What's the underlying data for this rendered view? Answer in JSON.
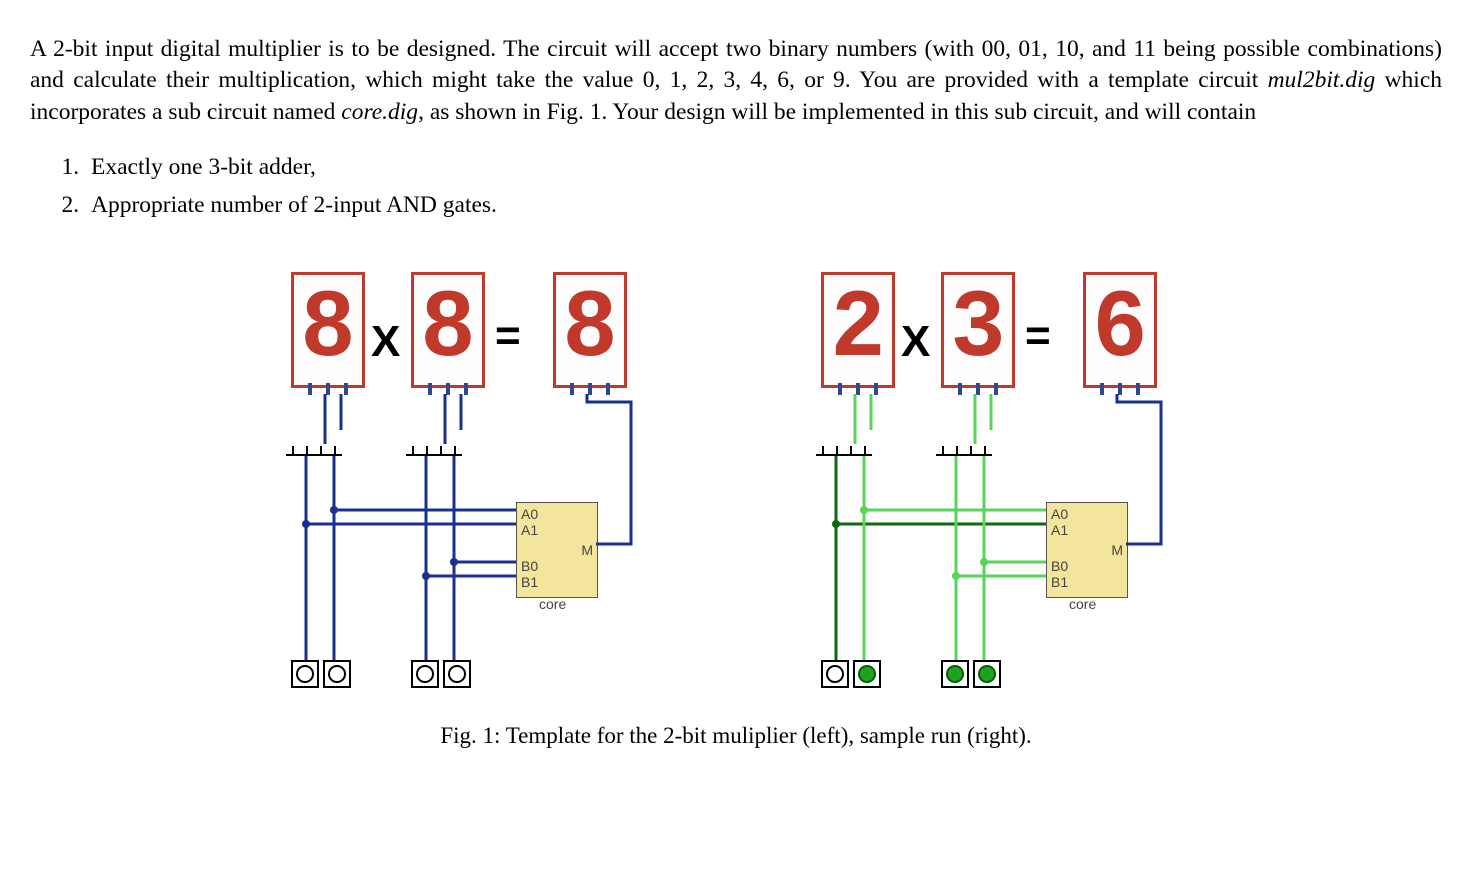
{
  "paragraph": {
    "sent1a": "A 2-bit input digital multiplier is to be designed. The circuit will accept two binary numbers (with 00, 01, 10, and 11 being possible combinations) and calculate their multiplication, which might take the value 0, 1, 2, 3, 4, 6, or 9. You are provided with a template circuit ",
    "file1": "mul2bit.dig",
    "sent1b": " which incorporates a sub circuit named ",
    "file2": "core.dig",
    "sent1c": ", as shown in Fig. 1. Your design will be implemented in this sub circuit, and will contain"
  },
  "requirements": [
    "Exactly one 3-bit adder,",
    "Appropriate number of 2-input AND gates."
  ],
  "figure": {
    "left": {
      "wire_color": "#1b2f8f",
      "digitA": "8",
      "digitB": "8",
      "digitR": "8",
      "ledA": [
        false,
        false
      ],
      "ledB": [
        false,
        false
      ]
    },
    "right": {
      "wire_color_on": "#39c23c",
      "wire_color_off": "#0b6b0b",
      "wire_color_out": "#1b2f8f",
      "digitA": "2",
      "digitB": "3",
      "digitR": "6",
      "ledA": [
        false,
        true
      ],
      "ledB": [
        true,
        true
      ]
    },
    "op_times": "X",
    "op_eq": "=",
    "core_label": "core",
    "pins": {
      "A0": "A0",
      "A1": "A1",
      "B0": "B0",
      "B1": "B1",
      "M": "M"
    },
    "caption": "Fig. 1: Template for the 2-bit muliplier (left), sample run (right)."
  }
}
